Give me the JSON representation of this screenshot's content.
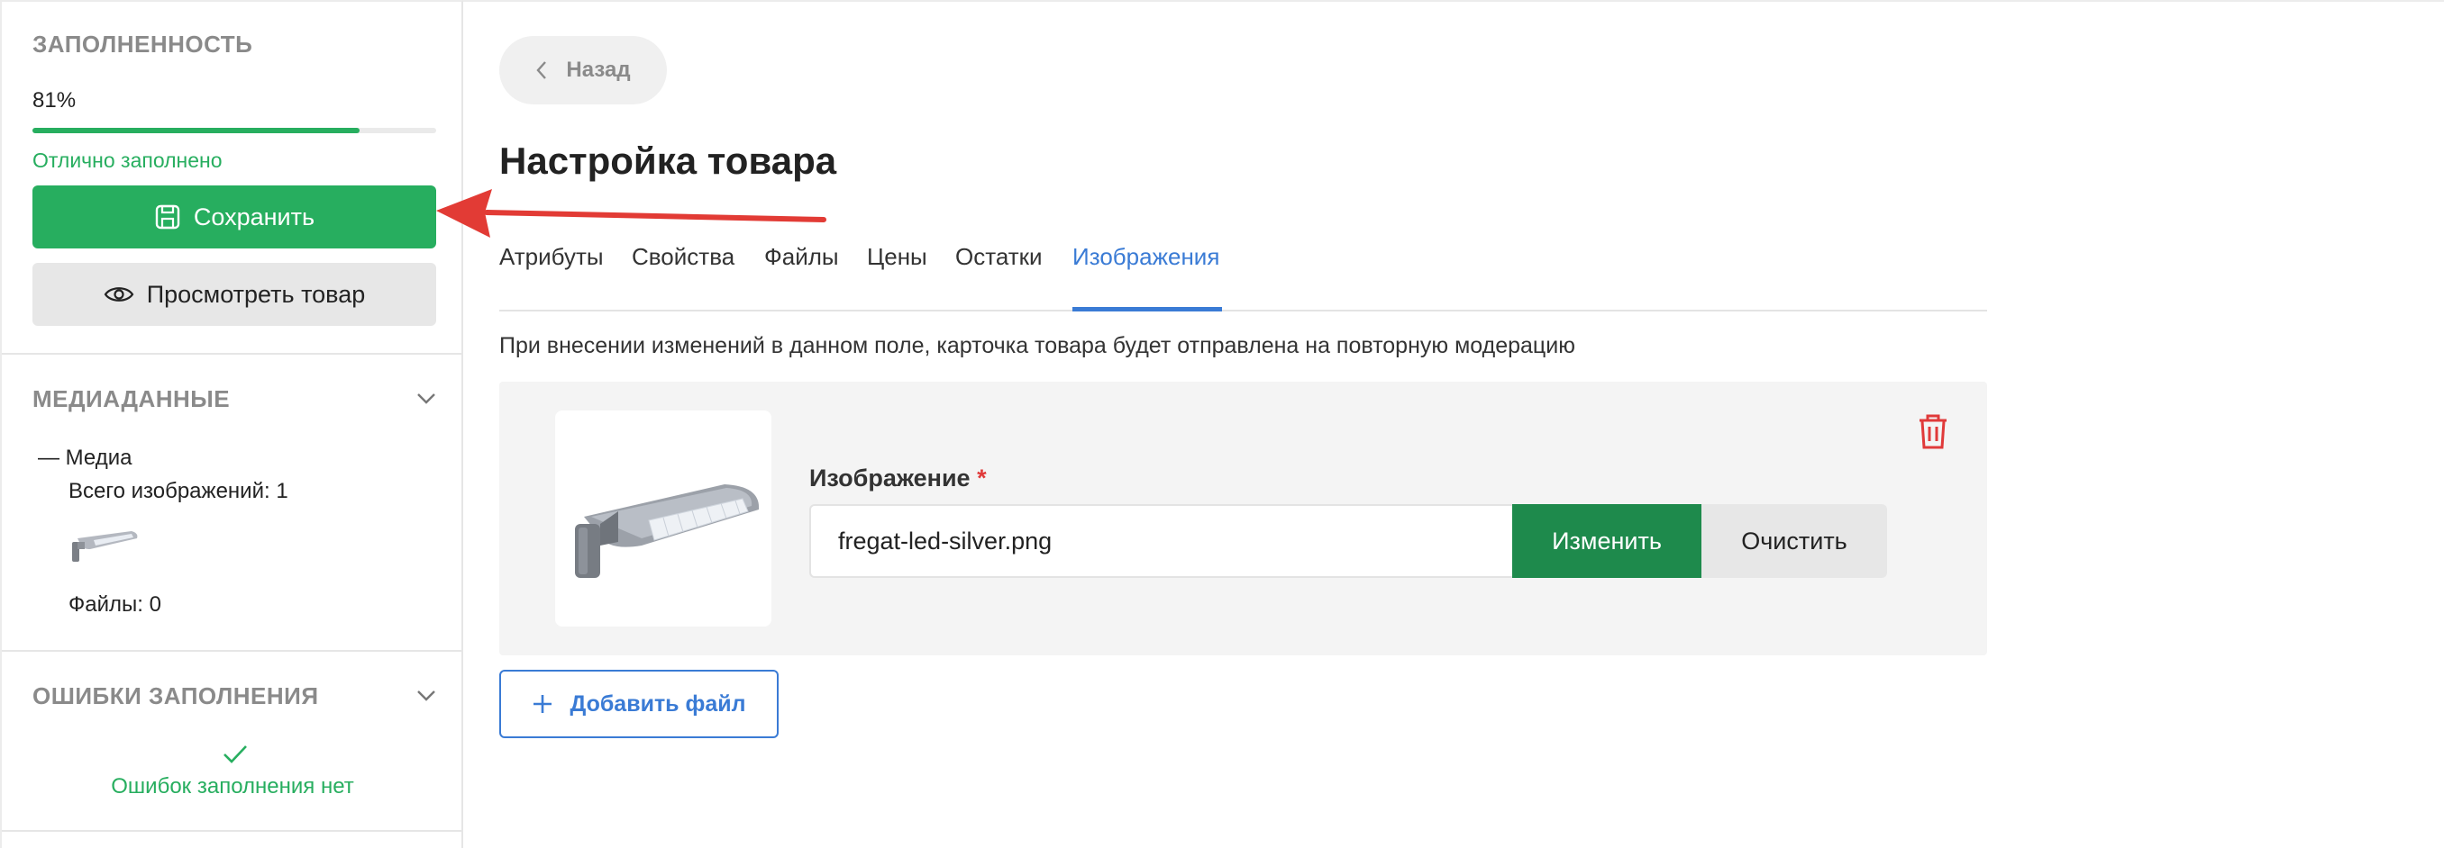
{
  "sidebar": {
    "fill": {
      "title": "ЗАПОЛНЕННОСТЬ",
      "percent_label": "81%",
      "progress_fraction": 0.81,
      "status": "Отлично заполнено",
      "save_label": "Сохранить",
      "view_label": "Просмотреть товар"
    },
    "media": {
      "title": "МЕДИАДАННЫЕ",
      "tree_label": "— Медиа",
      "images_total": "Всего изображений: 1",
      "files_total": "Файлы: 0"
    },
    "errors": {
      "title": "ОШИБКИ ЗАПОЛНЕНИЯ",
      "status": "Ошибок заполнения нет"
    }
  },
  "main": {
    "back_label": "Назад",
    "title": "Настройка товара",
    "tabs": [
      {
        "label": "Атрибуты"
      },
      {
        "label": "Свойства"
      },
      {
        "label": "Файлы"
      },
      {
        "label": "Цены"
      },
      {
        "label": "Остатки"
      },
      {
        "label": "Изображения"
      }
    ],
    "active_tab": "Изображения",
    "notice": "При внесении изменений в данном поле, карточка товара будет отправлена на повторную модерацию",
    "image_field": {
      "label": "Изображение",
      "required_mark": "*",
      "value": "fregat-led-silver.png",
      "change_label": "Изменить",
      "clear_label": "Очистить"
    },
    "add_file_label": "Добавить файл"
  },
  "colors": {
    "accent_green": "#27ae5f",
    "dark_green": "#1e8a4c",
    "link_blue": "#3a7bd5",
    "danger_red": "#e03a3a"
  },
  "icons": [
    "save-icon",
    "eye-icon",
    "chevron-down-icon",
    "chevron-left-icon",
    "check-icon",
    "trash-icon",
    "plus-icon",
    "arrow-annotation"
  ]
}
